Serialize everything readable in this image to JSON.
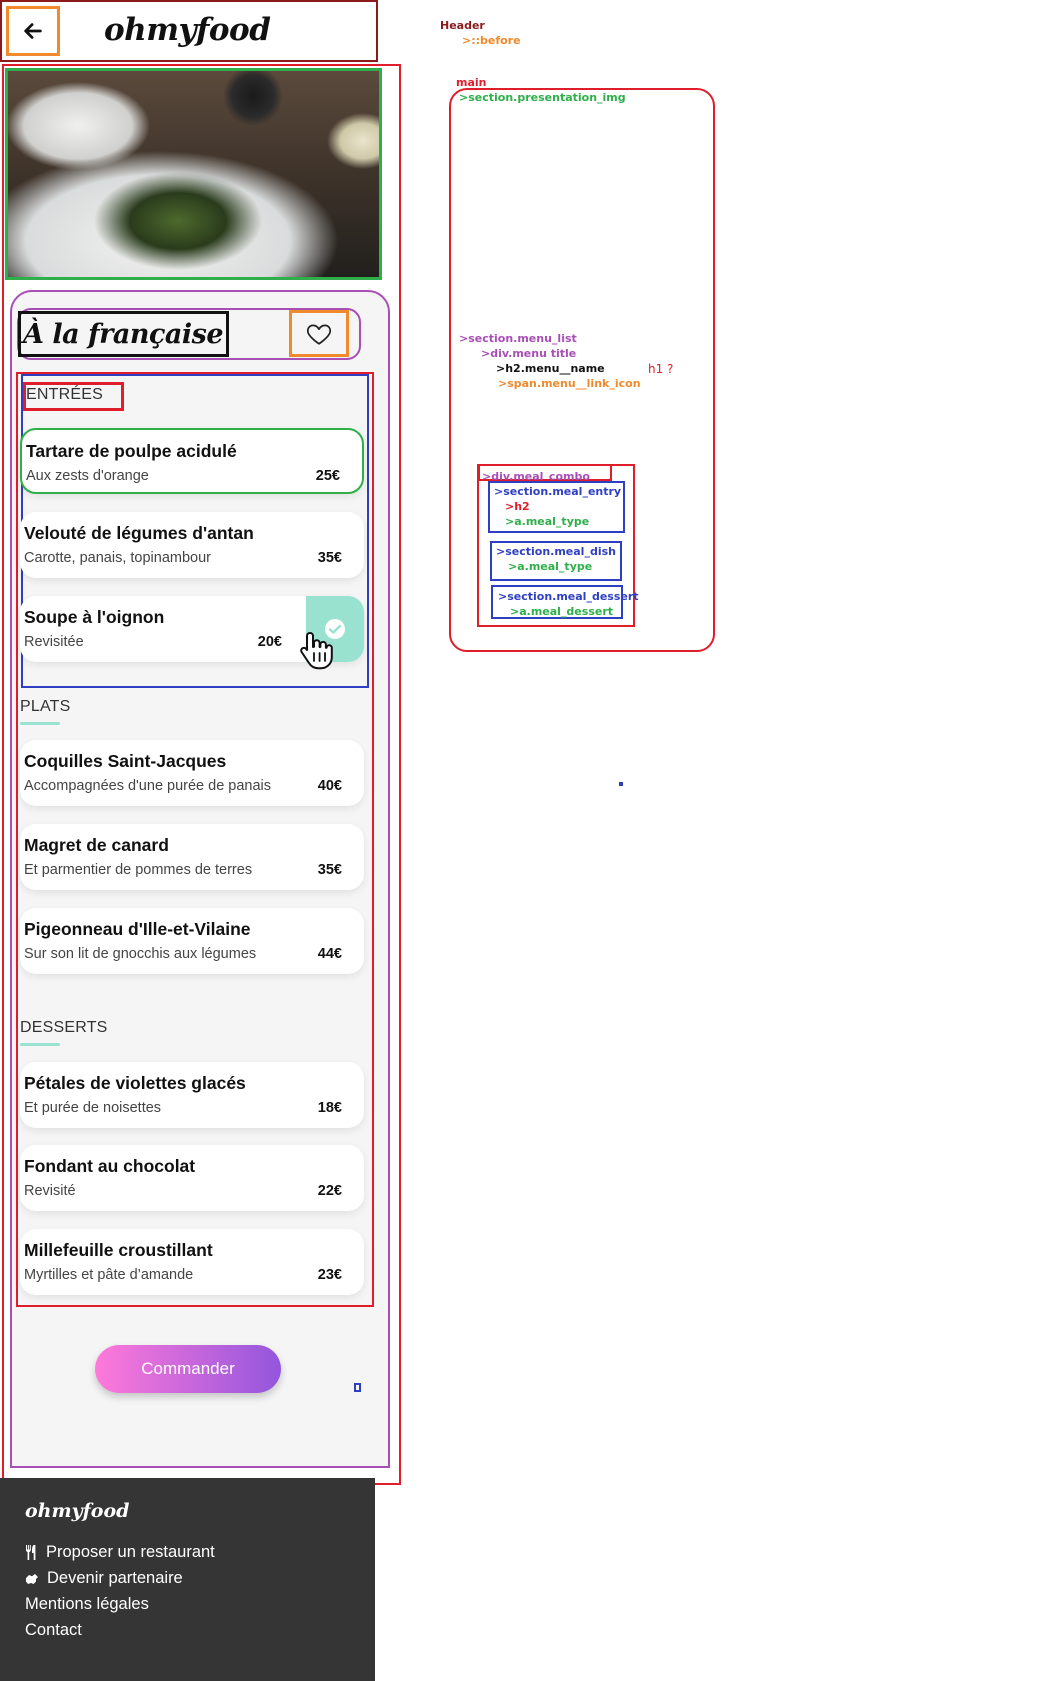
{
  "header": {
    "brand": "ohmyfood",
    "back_icon": "arrow-left-icon"
  },
  "menu": {
    "title": "À la française",
    "favorite_icon": "heart-outline-icon",
    "categories": [
      {
        "label": "ENTRÉES",
        "items": [
          {
            "dish": "Tartare de poulpe acidulé",
            "desc": "Aux zests d'orange",
            "price": "25€"
          },
          {
            "dish": "Velouté de légumes d'antan",
            "desc": "Carotte, panais, topinambour",
            "price": "35€"
          },
          {
            "dish": "Soupe à l'oignon",
            "desc": "Revisitée",
            "price": "20€",
            "selected": true
          }
        ]
      },
      {
        "label": "PLATS",
        "items": [
          {
            "dish": "Coquilles Saint-Jacques",
            "desc": "Accompagnées d'une purée de panais",
            "price": "40€"
          },
          {
            "dish": "Magret de canard",
            "desc": "Et parmentier de pommes de terres",
            "price": "35€"
          },
          {
            "dish": "Pigeonneau d'Ille-et-Vilaine",
            "desc": "Sur son lit de gnocchis aux légumes",
            "price": "44€"
          }
        ]
      },
      {
        "label": "DESSERTS",
        "items": [
          {
            "dish": "Pétales de violettes glacés",
            "desc": "Et purée de noisettes",
            "price": "18€"
          },
          {
            "dish": "Fondant au chocolat",
            "desc": "Revisité",
            "price": "22€"
          },
          {
            "dish": "Millefeuille croustillant",
            "desc": "Myrtilles et pâte d’amande",
            "price": "23€"
          }
        ]
      }
    ],
    "order_button": "Commander"
  },
  "footer": {
    "brand": "ohmyfood",
    "links": [
      {
        "label": "Proposer un restaurant",
        "icon": "utensils-icon"
      },
      {
        "label": "Devenir partenaire",
        "icon": "handshake-icon"
      },
      {
        "label": "Mentions légales"
      },
      {
        "label": "Contact"
      }
    ]
  },
  "annotations": {
    "header": "Header",
    "before": ">::before",
    "main": "main",
    "presentation_img": ">section.presentation_img",
    "menu_list": ">section.menu_list",
    "menutitle": ">div.menu title",
    "menu_name": ">h2.menu__name",
    "h1_question": "h1 ?",
    "link_icon": ">span.menu__link_icon",
    "meal_combo": ">div.meal_combo",
    "meal_entry": ">section.meal_entry",
    "h2": ">h2",
    "a_meal_type_1": ">a.meal_type",
    "meal_dish": ">section.meal_dish",
    "a_meal_type_2": ">a.meal_type",
    "meal_dessert": ">section.meal_dessert",
    "a_meal_dessert": ">a.meal_dessert"
  },
  "colors": {
    "accent": "#99e2d0",
    "button_start": "#ff79da",
    "button_end": "#9356dc",
    "footer_bg": "#353535"
  }
}
